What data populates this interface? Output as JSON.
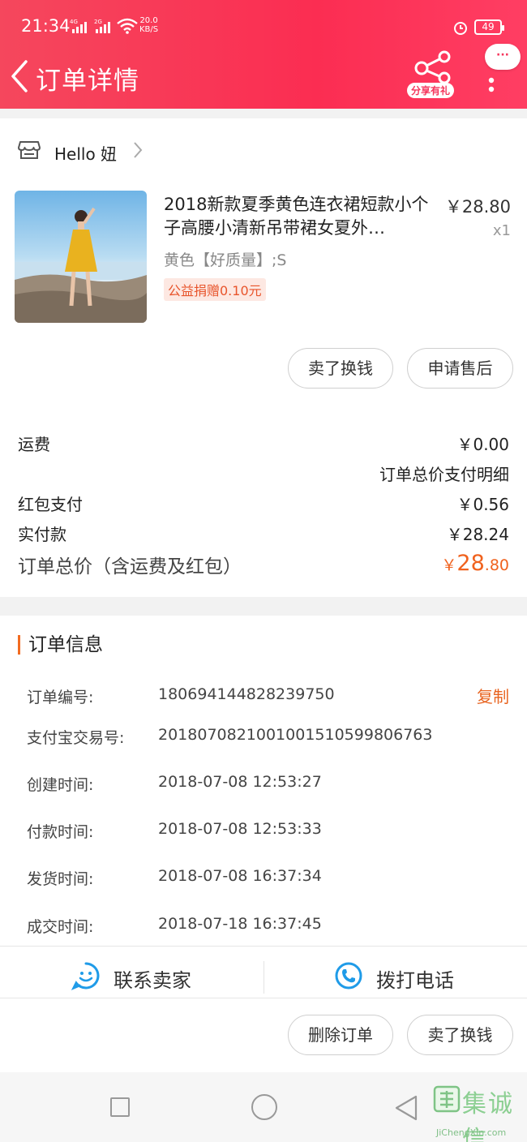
{
  "status_bar": {
    "time": "21:34",
    "network": "4G 2G",
    "speed_value": "20.0",
    "speed_unit": "KB/S",
    "battery": "49"
  },
  "header": {
    "title": "订单详情",
    "share_badge": "分享有礼",
    "message_bubble": "···"
  },
  "shop": {
    "name": "Hello 妞"
  },
  "product": {
    "title": "2018新款夏季黄色连衣裙短款小个子高腰小清新吊带裙女夏外…",
    "price": "￥28.80",
    "qty": "x1",
    "spec": "黄色【好质量】;S",
    "charity": "公益捐赠0.10元"
  },
  "product_actions": {
    "sell_exchange": "卖了换钱",
    "after_sale": "申请售后"
  },
  "fees": {
    "shipping_label": "运费",
    "shipping_value": "￥0.00",
    "breakdown_link": "订单总价支付明细",
    "redpacket_label": "红包支付",
    "redpacket_value": "￥0.56",
    "paid_label": "实付款",
    "paid_value": "￥28.24",
    "total_label": "订单总价（含运费及红包）",
    "total_currency": "￥",
    "total_int": "28",
    "total_dec": ".80"
  },
  "order_info": {
    "title": "订单信息",
    "copy": "复制",
    "rows": [
      {
        "k": "订单编号:",
        "v": "180694144828239750"
      },
      {
        "k": "支付宝交易号:",
        "v": "2018070821001001510599806763"
      },
      {
        "k": "创建时间:",
        "v": "2018-07-08 12:53:27"
      },
      {
        "k": "付款时间:",
        "v": "2018-07-08 12:53:33"
      },
      {
        "k": "发货时间:",
        "v": "2018-07-08 16:37:34"
      },
      {
        "k": "成交时间:",
        "v": "2018-07-18 16:37:45"
      }
    ]
  },
  "contact": {
    "seller": "联系卖家",
    "phone": "拨打电话"
  },
  "bottom_actions": {
    "delete": "删除订单",
    "sell_exchange": "卖了换钱"
  },
  "watermark": {
    "chars": "集诚信",
    "url": "JiChengXin.com"
  },
  "colors": {
    "header": "#fb2d52",
    "accent_orange": "#f0621e",
    "contact_blue": "#1f9be8"
  }
}
